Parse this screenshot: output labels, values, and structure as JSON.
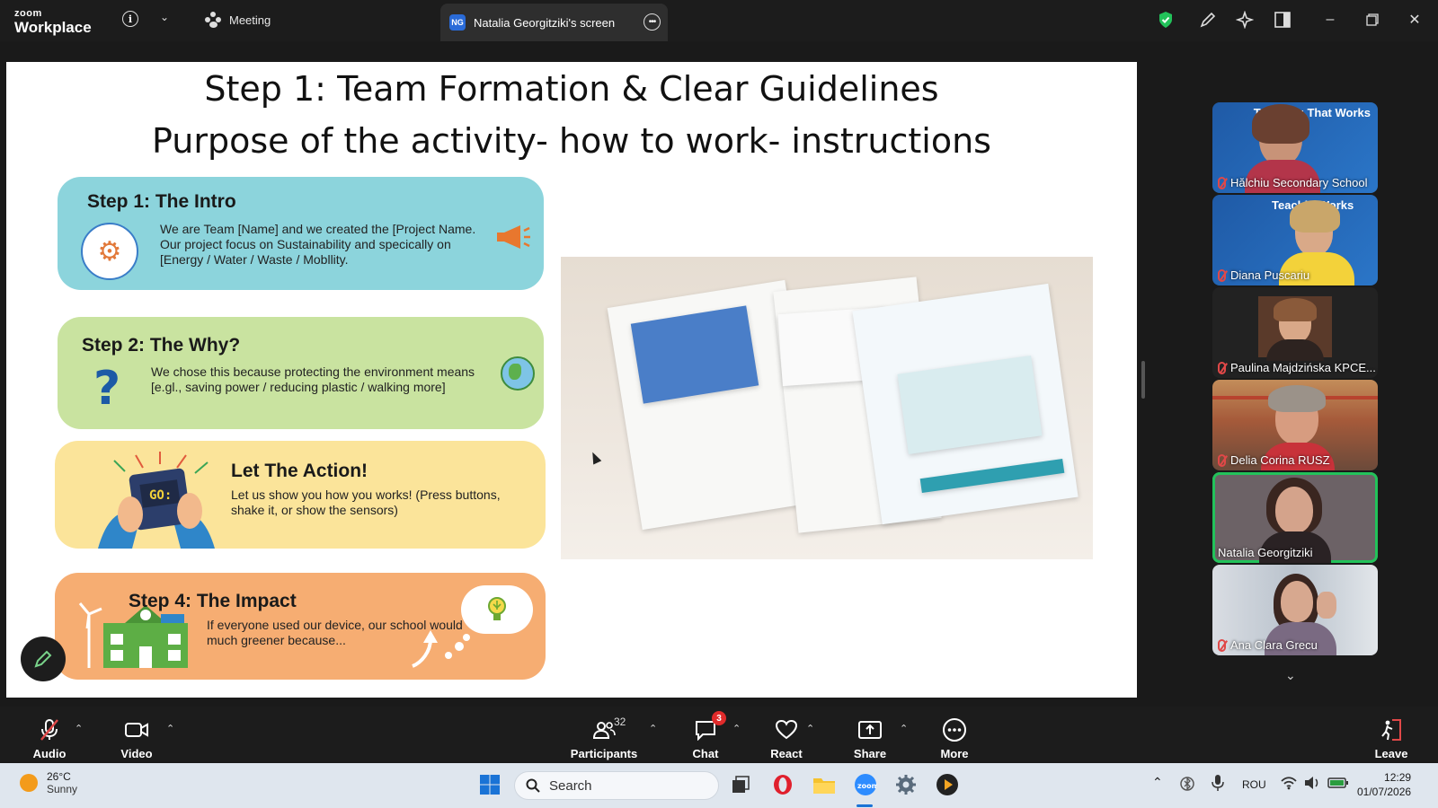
{
  "app": {
    "logo_top": "zoom",
    "logo_bottom": "Workplace"
  },
  "titlebar": {
    "meeting_label": "Meeting",
    "share_tab_avatar": "NG",
    "share_tab_label": "Natalia Georgitziki's screen"
  },
  "slide": {
    "title1": "Step 1: Team Formation & Clear Guidelines",
    "title2": "Purpose of the activity- how to work- instructions",
    "cards": [
      {
        "heading": "Step 1: The Intro",
        "text": "We are Team [Name] and we created the [Project Name. Our project focus on Sustainability and specically on [Energy / Water / Waste / Mobllity."
      },
      {
        "heading": "Step 2: The Why?",
        "text": "We chose this because protecting the environment means [e.gl., saving power / reducing plastic / walking more]"
      },
      {
        "heading": "Let The Action!",
        "text": "Let us show you how you works! (Press buttons, shake it, or show the sensors)"
      },
      {
        "heading": "Step 4: The Impact",
        "text": "If everyone used our device, our school would much greener because..."
      }
    ],
    "device_label": "GO:"
  },
  "participants": [
    {
      "name": "Hălchiu Secondary School",
      "banner": "Teaching That Works"
    },
    {
      "name": "Diana Puscariu",
      "banner": "Teachin Works"
    },
    {
      "name": "Paulina Majdzińska KPCE..."
    },
    {
      "name": "Delia Corina RUSZ"
    },
    {
      "name": "Natalia Georgitziki"
    },
    {
      "name": "Ana Clara Grecu"
    }
  ],
  "toolbar": {
    "audio": "Audio",
    "video": "Video",
    "participants": "Participants",
    "participants_count": "32",
    "chat": "Chat",
    "chat_badge": "3",
    "react": "React",
    "share": "Share",
    "more": "More",
    "leave": "Leave"
  },
  "taskbar": {
    "temperature": "26°C",
    "weather": "Sunny",
    "search_placeholder": "Search",
    "language": "ROU",
    "time": "12:29",
    "date": "01/07/2026"
  },
  "colors": {
    "card1": "#8cd4dc",
    "card2": "#c9e3a0",
    "card3": "#fbe49a",
    "card4": "#f6ad72",
    "active_speaker": "#22c25a",
    "mute": "#e04848"
  }
}
